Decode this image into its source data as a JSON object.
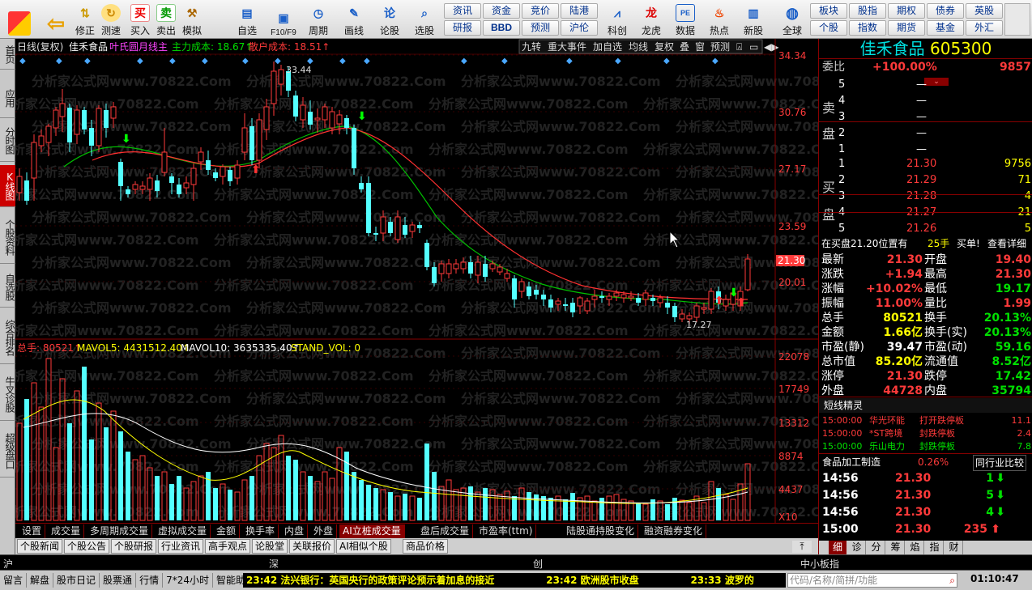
{
  "toolbar": {
    "buttons": [
      "修正",
      "测速",
      "买入",
      "卖出",
      "模拟",
      "自选",
      "F10/F9",
      "周期",
      "画线",
      "论股",
      "选股",
      "科创",
      "龙虎",
      "数据",
      "热点",
      "新股",
      "全球"
    ],
    "grid1": [
      "资讯",
      "资金",
      "竞价",
      "陆港",
      "板块",
      "股指",
      "期权",
      "债券",
      "英股"
    ],
    "grid2": [
      "研报",
      "BBD",
      "预测",
      "沪伦",
      "个股",
      "指数",
      "期货",
      "基金",
      "外汇"
    ]
  },
  "leftnav": [
    "首页",
    "应用",
    "分时图",
    "K线图",
    "个股资料",
    "自选股",
    "综合排名",
    "牛叉诊股",
    "超级盘口"
  ],
  "chart": {
    "header_left": "日线(复权)",
    "stock": "佳禾食品",
    "indicator": "叶氏圆月线主",
    "main_cost": "主力成本: 18.67↑",
    "retail_cost": "散户成本: 18.51↑",
    "header_right": [
      "九转",
      "重大事件",
      "加自选",
      "均线",
      "复权",
      "叠",
      "窗",
      "预测"
    ],
    "price_axis": [
      "34.34",
      "30.76",
      "27.17",
      "23.59",
      "20.01"
    ],
    "current_price": "21.30",
    "high_label": "33.44",
    "low_label": "17.27",
    "vol_header": {
      "total": "总手: 80521↑",
      "mavol5": "MAVOL5: 4431512.40↑",
      "mavol10": "MAVOL10: 3635335.40↑",
      "stand": "STAND_VOL: 0"
    },
    "vol_axis": [
      "22078",
      "17749",
      "13312",
      "8874",
      "4437",
      "X10"
    ],
    "watermark": "分析家公式网www.70822.Com"
  },
  "tabs1": [
    "设置",
    "成交量",
    "多周期成交量",
    "虚拟成交量",
    "金额",
    "换手率",
    "内盘",
    "外盘",
    "AI立桩成交量",
    "盘后成交量",
    "市盈率(ttm)",
    "陆股通持股变化",
    "融资融券变化"
  ],
  "tabs2": [
    "个股新闻",
    "个股公告",
    "个股研报",
    "行业资讯",
    "高手观点",
    "论股堂",
    "关联报价",
    "AI相似个股",
    "商品价格"
  ],
  "index_bar": [
    "沪",
    "深",
    "创",
    "中小板指"
  ],
  "status": {
    "items": [
      "留言",
      "解盘",
      "股市日记",
      "股票通",
      "行情",
      "7*24小时",
      "智能助手"
    ],
    "ticker1": "23:42 法兴银行：英国央行的政策评论预示着加息的接近",
    "ticker2": "23:42 欧洲股市收盘",
    "ticker3": "23:33 波罗的",
    "search": "代码/名称/简拼/功能",
    "time": "01:10:47"
  },
  "right": {
    "title": "佳禾食品",
    "code": "605300",
    "weibi_label": "委比",
    "weibi": "+100.00%",
    "weibi_val": "9857",
    "sell_label": [
      "卖",
      "盘"
    ],
    "buy_label": [
      "买",
      "盘"
    ],
    "sells": [
      {
        "n": "5",
        "p": "—"
      },
      {
        "n": "4",
        "p": "—"
      },
      {
        "n": "3",
        "p": "—"
      },
      {
        "n": "2",
        "p": "—"
      },
      {
        "n": "1",
        "p": "—"
      }
    ],
    "buys": [
      {
        "n": "1",
        "p": "21.30",
        "v": "9756"
      },
      {
        "n": "2",
        "p": "21.29",
        "v": "71"
      },
      {
        "n": "3",
        "p": "21.28",
        "v": "4"
      },
      {
        "n": "4",
        "p": "21.27",
        "v": "21"
      },
      {
        "n": "5",
        "p": "21.26",
        "v": "5"
      }
    ],
    "buy_notice": "在买盘21.20位置有",
    "buy_notice_qty": "25手",
    "buy_notice_tail": "买单!",
    "detail": "查看详细",
    "stats": [
      [
        "最新",
        "21.30",
        "开盘",
        "19.40"
      ],
      [
        "涨跌",
        "+1.94",
        "最高",
        "21.30"
      ],
      [
        "涨幅",
        "+10.02%",
        "最低",
        "19.17"
      ],
      [
        "振幅",
        "11.00%",
        "量比",
        "1.99"
      ],
      [
        "总手",
        "80521",
        "换手",
        "20.13%"
      ],
      [
        "金额",
        "1.66亿",
        "换手(实)",
        "20.13%"
      ],
      [
        "市盈(静)",
        "39.47",
        "市盈(动)",
        "59.16"
      ],
      [
        "总市值",
        "85.20亿",
        "流通值",
        "8.52亿"
      ],
      [
        "涨停",
        "21.30",
        "跌停",
        "17.42"
      ],
      [
        "外盘",
        "44728",
        "内盘",
        "35794"
      ]
    ],
    "sprite_title": "短线精灵",
    "sprite": [
      [
        "15:00:00",
        "华光环能",
        "打开跌停板",
        "11.1"
      ],
      [
        "15:00:00",
        "*ST跨境",
        "封跌停板",
        "2.4"
      ],
      [
        "15:00:00",
        "乐山电力",
        "封跌停板",
        "7.8"
      ]
    ],
    "industry": "食品加工制造",
    "industry_chg": "0.26%",
    "industry_link": "同行业比较",
    "trades": [
      [
        "14:56",
        "21.30",
        "1"
      ],
      [
        "14:56",
        "21.30",
        "5"
      ],
      [
        "14:56",
        "21.30",
        "4"
      ],
      [
        "15:00",
        "21.30",
        "235"
      ]
    ],
    "bottom_tabs": [
      "细",
      "诊",
      "分",
      "筹",
      "焰",
      "指",
      "财"
    ]
  }
}
